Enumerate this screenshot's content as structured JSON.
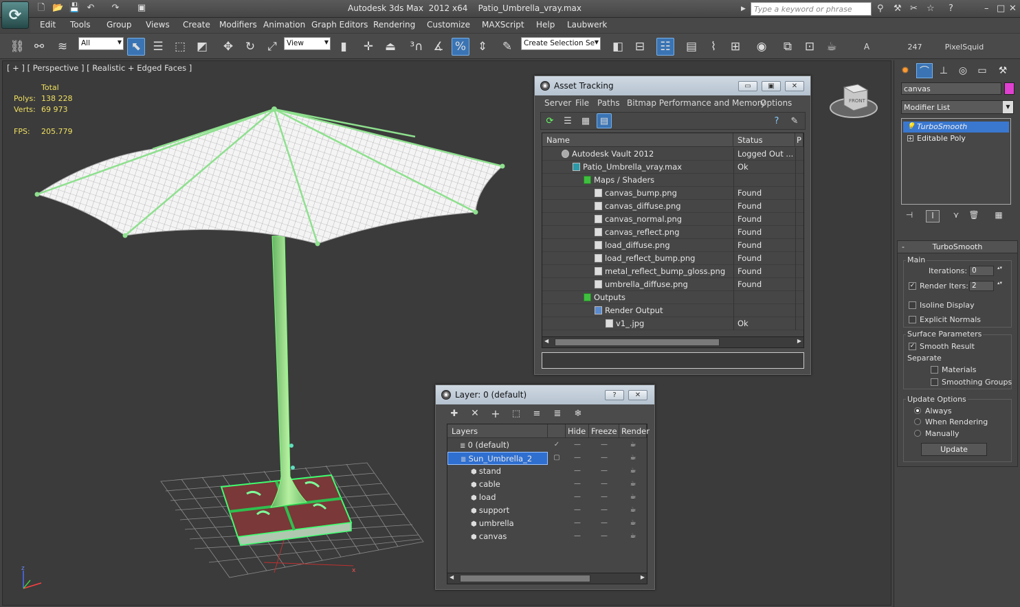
{
  "window": {
    "app_title": "Autodesk 3ds Max  2012 x64",
    "file_title": "Patio_Umbrella_vray.max",
    "search_placeholder": "Type a keyword or phrase"
  },
  "menu": [
    "Edit",
    "Tools",
    "Group",
    "Views",
    "Create",
    "Modifiers",
    "Animation",
    "Graph Editors",
    "Rendering",
    "Customize",
    "MAXScript",
    "Help",
    "Laubwerk"
  ],
  "toolbar": {
    "selection_filter": "All",
    "ref_coord": "View",
    "named_selection": "Create Selection Se",
    "label_a": "A",
    "count": "247",
    "plugin_label": "PixelSquid"
  },
  "viewport": {
    "label": "[ + ] [ Perspective ] [ Realistic + Edged Faces ]",
    "stats_header": "Total",
    "polys_label": "Polys:",
    "polys_value": "138 228",
    "verts_label": "Verts:",
    "verts_value": "69 973",
    "fps_label": "FPS:",
    "fps_value": "205.779",
    "viewcube_label": "FRONT",
    "axis_z": "z",
    "axis_x": "x"
  },
  "command_panel": {
    "object_name": "canvas",
    "object_color": "#e040d0",
    "modifier_list": "Modifier List",
    "stack": [
      "TurboSmooth",
      "Editable Poly"
    ],
    "rollout_title": "TurboSmooth",
    "main_group": "Main",
    "iterations_label": "Iterations:",
    "iterations_value": "0",
    "render_iters_label": "Render Iters:",
    "render_iters_value": "2",
    "isoline_label": "Isoline Display",
    "explicit_normals_label": "Explicit Normals",
    "surface_group": "Surface Parameters",
    "smooth_result_label": "Smooth Result",
    "separate_label": "Separate",
    "materials_label": "Materials",
    "smoothing_groups_label": "Smoothing Groups",
    "update_group": "Update Options",
    "always_label": "Always",
    "when_rendering_label": "When Rendering",
    "manually_label": "Manually",
    "update_button": "Update"
  },
  "asset_tracking": {
    "title": "Asset Tracking",
    "menu": [
      "Server",
      "File",
      "Paths",
      "Bitmap Performance and Memory",
      "Options"
    ],
    "columns": [
      "Name",
      "Status",
      "P"
    ],
    "rows": [
      {
        "name": "Autodesk Vault 2012",
        "status": "Logged Out ..."
      },
      {
        "name": "Patio_Umbrella_vray.max",
        "status": "Ok"
      },
      {
        "name": "Maps / Shaders",
        "status": ""
      },
      {
        "name": "canvas_bump.png",
        "status": "Found"
      },
      {
        "name": "canvas_diffuse.png",
        "status": "Found"
      },
      {
        "name": "canvas_normal.png",
        "status": "Found"
      },
      {
        "name": "canvas_reflect.png",
        "status": "Found"
      },
      {
        "name": "load_diffuse.png",
        "status": "Found"
      },
      {
        "name": "load_reflect_bump.png",
        "status": "Found"
      },
      {
        "name": "metal_reflect_bump_gloss.png",
        "status": "Found"
      },
      {
        "name": "umbrella_diffuse.png",
        "status": "Found"
      },
      {
        "name": "Outputs",
        "status": ""
      },
      {
        "name": "Render Output",
        "status": ""
      },
      {
        "name": "v1_.jpg",
        "status": "Ok"
      }
    ]
  },
  "layer_dialog": {
    "title": "Layer: 0 (default)",
    "columns": [
      "Layers",
      "Hide",
      "Freeze",
      "Render"
    ],
    "rows": [
      {
        "name": "0 (default)"
      },
      {
        "name": "Sun_Umbrella_2"
      },
      {
        "name": "stand"
      },
      {
        "name": "cable"
      },
      {
        "name": "load"
      },
      {
        "name": "support"
      },
      {
        "name": "umbrella"
      },
      {
        "name": "canvas"
      }
    ]
  }
}
